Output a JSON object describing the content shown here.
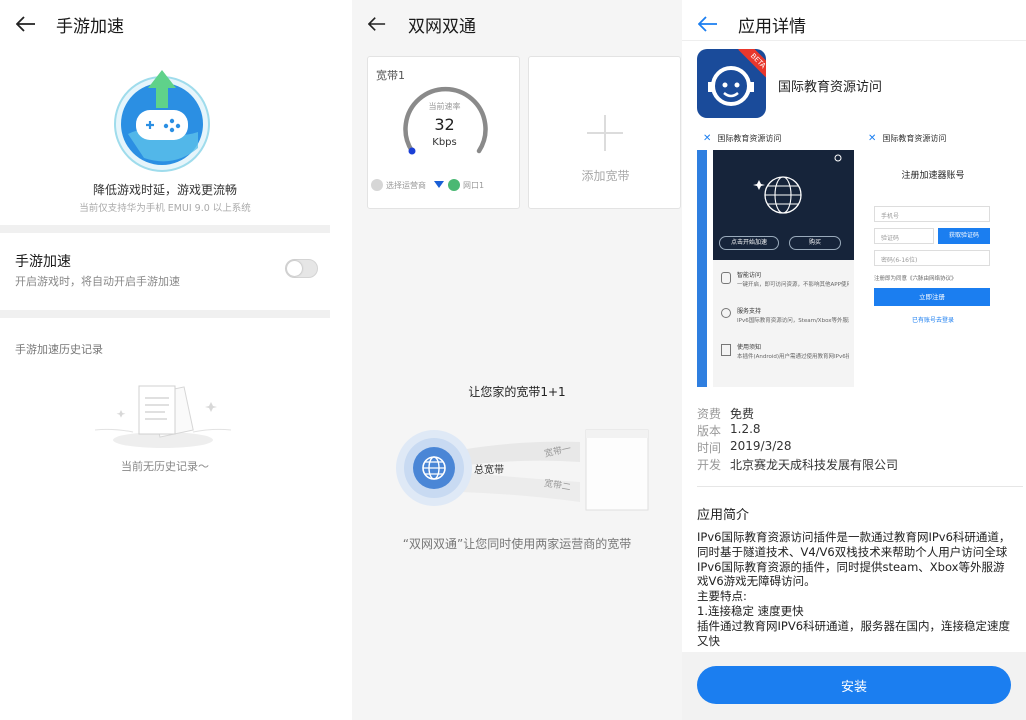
{
  "colors": {
    "accent": "#1b7ef0",
    "gauge_dot": "#1a3fd6",
    "app_icon_bg": "#1a4b9a",
    "separator": "#f0f0f0"
  },
  "game_accel": {
    "title": "手游加速",
    "hero_caption": "降低游戏时延，游戏更流畅",
    "hero_sub": "当前仅支持华为手机 EMUI 9.0 以上系统",
    "setting_title": "手游加速",
    "setting_desc": "开启游戏时，将自动开启手游加速",
    "toggle_on": false,
    "history_title": "手游加速历史记录",
    "empty_text": "当前无历史记录～"
  },
  "dual_net": {
    "title": "双网双通",
    "card": {
      "label": "宽带1",
      "speed_label": "当前速率",
      "speed_value": "32",
      "speed_unit": "Kbps",
      "carrier_label": "选择运营商",
      "port_label": "网口1"
    },
    "add_label": "添加宽带",
    "promo_title": "让您家的宽带1+1",
    "diagram": {
      "center": "总宽带",
      "line1": "宽带一",
      "line2": "宽带二"
    },
    "promo_desc": "“双网双通”让您同时使用两家运营商的宽带"
  },
  "app_detail": {
    "title": "应用详情",
    "app_name": "国际教育资源访问",
    "beta_badge": "BETA",
    "screenshot1": {
      "header": "国际教育资源访问",
      "btn_start": "点击开始加速",
      "btn_buy": "购买",
      "items": [
        {
          "title": "智能访问",
          "desc": "一键开启，即可访问资源，不影响其他APP使用"
        },
        {
          "title": "服务支持",
          "desc": "IPv6国际教育资源访问，Steam/Xbox等外服游戏支持"
        },
        {
          "title": "使用须知",
          "desc": "本插件(Android)用户需通过使用教育网IPv6接入，若不能使用请切换。"
        }
      ]
    },
    "screenshot2": {
      "header": "国际教育资源访问",
      "title": "注册加速器账号",
      "phone_placeholder": "手机号",
      "code_placeholder": "验证码",
      "code_button": "获取验证码",
      "pwd_placeholder": "密码(6-16位)",
      "agree_text": "注册即为同意《六脉由网络协议》",
      "register_button": "立即注册",
      "login_link": "已有账号去登录"
    },
    "info": [
      {
        "k": "资费",
        "v": "免费"
      },
      {
        "k": "版本",
        "v": "1.2.8"
      },
      {
        "k": "时间",
        "v": "2019/3/28"
      },
      {
        "k": "开发",
        "v": "北京赛龙天成科技发展有限公司"
      }
    ],
    "intro_title": "应用简介",
    "intro_lines": [
      "IPv6国际教育资源访问插件是一款通过教育网IPv6科研通道，同时基于隧道技术、V4/V6双栈技术来帮助个人用户访问全球IPv6国际教育资源的插件，同时提供steam、Xbox等外服游戏V6游戏无障碍访问。",
      "主要特点:",
      "1.连接稳定 速度更快",
      "插件通过教育网IPV6科研通道，服务器在国内，连接稳定速度又快"
    ],
    "install_label": "安装"
  }
}
